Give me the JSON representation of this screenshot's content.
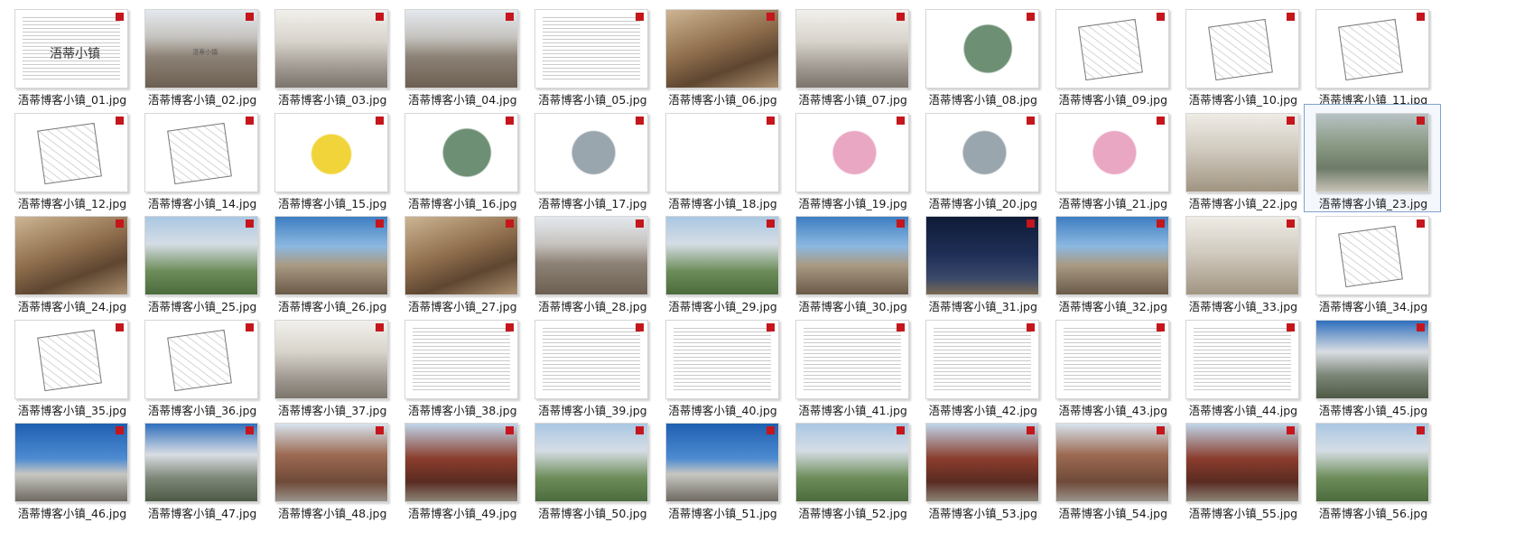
{
  "window": {
    "selected_file": "浯蒂博客小镇_23.jpg"
  },
  "files": [
    {
      "name": "浯蒂博客小镇_01.jpg",
      "style": "t-doc",
      "mark": "title"
    },
    {
      "name": "浯蒂博客小镇_02.jpg",
      "style": "t-photo-street",
      "mark": "title-small"
    },
    {
      "name": "浯蒂博客小镇_03.jpg",
      "style": "t-photo-ink"
    },
    {
      "name": "浯蒂博客小镇_04.jpg",
      "style": "t-photo-street"
    },
    {
      "name": "浯蒂博客小镇_05.jpg",
      "style": "t-doc"
    },
    {
      "name": "浯蒂博客小镇_06.jpg",
      "style": "t-photo-warm"
    },
    {
      "name": "浯蒂博客小镇_07.jpg",
      "style": "t-photo-ink"
    },
    {
      "name": "浯蒂博客小镇_08.jpg",
      "style": "t-map-colour"
    },
    {
      "name": "浯蒂博客小镇_09.jpg",
      "style": "t-line-plan"
    },
    {
      "name": "浯蒂博客小镇_10.jpg",
      "style": "t-line-plan"
    },
    {
      "name": "浯蒂博客小镇_11.jpg",
      "style": "t-line-plan"
    },
    {
      "name": "浯蒂博客小镇_12.jpg",
      "style": "t-line-plan"
    },
    {
      "name": "浯蒂博客小镇_14.jpg",
      "style": "t-line-plan"
    },
    {
      "name": "浯蒂博客小镇_15.jpg",
      "style": "t-yellow"
    },
    {
      "name": "浯蒂博客小镇_16.jpg",
      "style": "t-map-colour"
    },
    {
      "name": "浯蒂博客小镇_17.jpg",
      "style": "t-red-plan"
    },
    {
      "name": "浯蒂博客小镇_18.jpg",
      "style": "t-section"
    },
    {
      "name": "浯蒂博客小镇_19.jpg",
      "style": "t-pink-plan"
    },
    {
      "name": "浯蒂博客小镇_20.jpg",
      "style": "t-red-plan"
    },
    {
      "name": "浯蒂博客小镇_21.jpg",
      "style": "t-pink-plan"
    },
    {
      "name": "浯蒂博客小镇_22.jpg",
      "style": "t-sepia"
    },
    {
      "name": "浯蒂博客小镇_23.jpg",
      "style": "t-aerial",
      "selected": true
    },
    {
      "name": "浯蒂博客小镇_24.jpg",
      "style": "t-photo-warm"
    },
    {
      "name": "浯蒂博客小镇_25.jpg",
      "style": "t-green"
    },
    {
      "name": "浯蒂博客小镇_26.jpg",
      "style": "t-sky"
    },
    {
      "name": "浯蒂博客小镇_27.jpg",
      "style": "t-photo-warm"
    },
    {
      "name": "浯蒂博客小镇_28.jpg",
      "style": "t-photo-street"
    },
    {
      "name": "浯蒂博客小镇_29.jpg",
      "style": "t-green"
    },
    {
      "name": "浯蒂博客小镇_30.jpg",
      "style": "t-sky"
    },
    {
      "name": "浯蒂博客小镇_31.jpg",
      "style": "t-night"
    },
    {
      "name": "浯蒂博客小镇_32.jpg",
      "style": "t-sky"
    },
    {
      "name": "浯蒂博客小镇_33.jpg",
      "style": "t-sepia"
    },
    {
      "name": "浯蒂博客小镇_34.jpg",
      "style": "t-line-plan"
    },
    {
      "name": "浯蒂博客小镇_35.jpg",
      "style": "t-line-plan"
    },
    {
      "name": "浯蒂博客小镇_36.jpg",
      "style": "t-line-plan"
    },
    {
      "name": "浯蒂博客小镇_37.jpg",
      "style": "t-photo-ink"
    },
    {
      "name": "浯蒂博客小镇_38.jpg",
      "style": "t-doc"
    },
    {
      "name": "浯蒂博客小镇_39.jpg",
      "style": "t-doc"
    },
    {
      "name": "浯蒂博客小镇_40.jpg",
      "style": "t-doc"
    },
    {
      "name": "浯蒂博客小镇_41.jpg",
      "style": "t-doc"
    },
    {
      "name": "浯蒂博客小镇_42.jpg",
      "style": "t-doc"
    },
    {
      "name": "浯蒂博客小镇_43.jpg",
      "style": "t-doc"
    },
    {
      "name": "浯蒂博客小镇_44.jpg",
      "style": "t-doc"
    },
    {
      "name": "浯蒂博客小镇_45.jpg",
      "style": "t-whitehouse"
    },
    {
      "name": "浯蒂博客小镇_46.jpg",
      "style": "t-gate"
    },
    {
      "name": "浯蒂博客小镇_47.jpg",
      "style": "t-whitehouse"
    },
    {
      "name": "浯蒂博客小镇_48.jpg",
      "style": "t-brick"
    },
    {
      "name": "浯蒂博客小镇_49.jpg",
      "style": "t-redbuild"
    },
    {
      "name": "浯蒂博客小镇_50.jpg",
      "style": "t-green"
    },
    {
      "name": "浯蒂博客小镇_51.jpg",
      "style": "t-gate"
    },
    {
      "name": "浯蒂博客小镇_52.jpg",
      "style": "t-green"
    },
    {
      "name": "浯蒂博客小镇_53.jpg",
      "style": "t-redbuild"
    },
    {
      "name": "浯蒂博客小镇_54.jpg",
      "style": "t-brick"
    },
    {
      "name": "浯蒂博客小镇_55.jpg",
      "style": "t-redbuild"
    },
    {
      "name": "浯蒂博客小镇_56.jpg",
      "style": "t-green"
    }
  ],
  "marks": {
    "title_text": "浯蒂小镇"
  },
  "colors": {
    "corner_badge": "#c4161c",
    "selection_border": "#7da2ce"
  },
  "icons": {
    "corner_badge": "red-square-badge-icon"
  }
}
